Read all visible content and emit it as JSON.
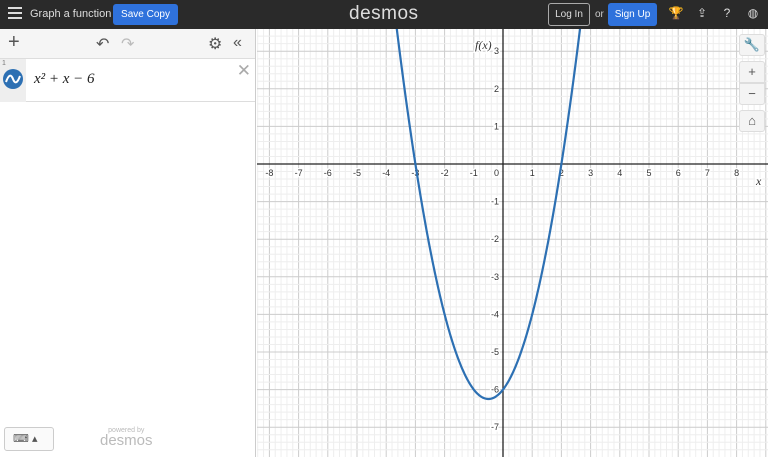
{
  "header": {
    "title": "Graph a function",
    "save_label": "Save Copy",
    "logo": "desmos",
    "login_label": "Log In",
    "or_text": "or",
    "signup_label": "Sign Up"
  },
  "expressions": [
    {
      "index": "1",
      "latex_display": "x² + x − 6",
      "color": "#2d70b3"
    }
  ],
  "footer": {
    "powered_by": "powered by",
    "brand": "desmos"
  },
  "graph": {
    "x_axis_label": "x",
    "y_axis_label": "f(x)",
    "x_ticks": [
      -8,
      -7,
      -6,
      -5,
      -4,
      -3,
      -2,
      -1,
      1,
      2,
      3,
      4,
      5,
      6,
      7,
      8
    ],
    "y_ticks": [
      3,
      2,
      1,
      -1,
      -2,
      -3,
      -4,
      -5,
      -6,
      -7
    ],
    "origin_label": "0",
    "function": {
      "a": 1,
      "b": 1,
      "c": -6
    },
    "color": "#2d70b3"
  },
  "colors": {
    "accent": "#2f72dc",
    "topbar": "#2a2a2a"
  }
}
